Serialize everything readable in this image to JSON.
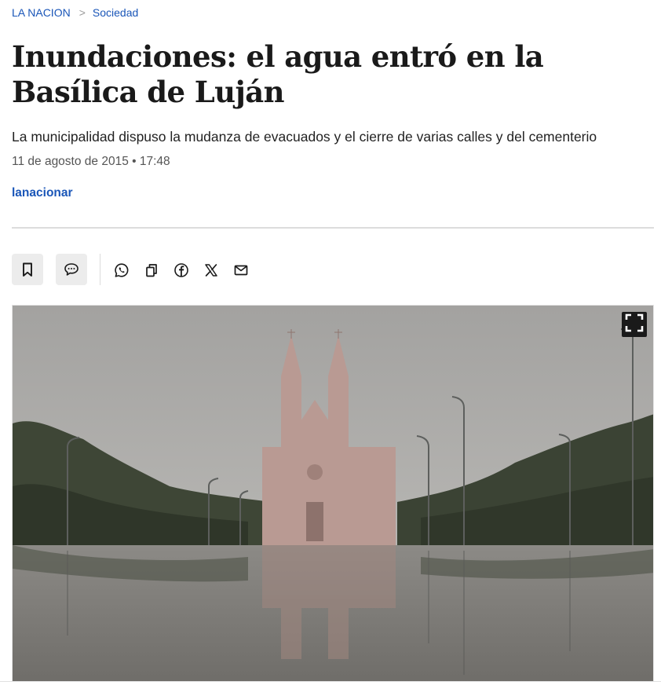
{
  "breadcrumb": {
    "home": "LA NACION",
    "separator": ">",
    "section": "Sociedad"
  },
  "article": {
    "headline": "Inundaciones: el agua entró en la Basílica de Luján",
    "subtitle": "La municipalidad dispuso la mudanza de evacuados y el cierre de varias calles y del cementerio",
    "dateline": "11 de agosto de 2015 • 17:48",
    "author": "lanacionar"
  },
  "actions": {
    "icons": [
      "bookmark-icon",
      "comment-icon",
      "whatsapp-icon",
      "copy-link-icon",
      "facebook-icon",
      "x-icon",
      "email-icon"
    ]
  },
  "photo": {
    "icons": [
      "fullscreen-icon"
    ]
  },
  "colors": {
    "link_blue": "#1a56b8",
    "headline": "#1a1a1a",
    "pill_bg": "#ececec",
    "divider": "#dcdcdc"
  }
}
